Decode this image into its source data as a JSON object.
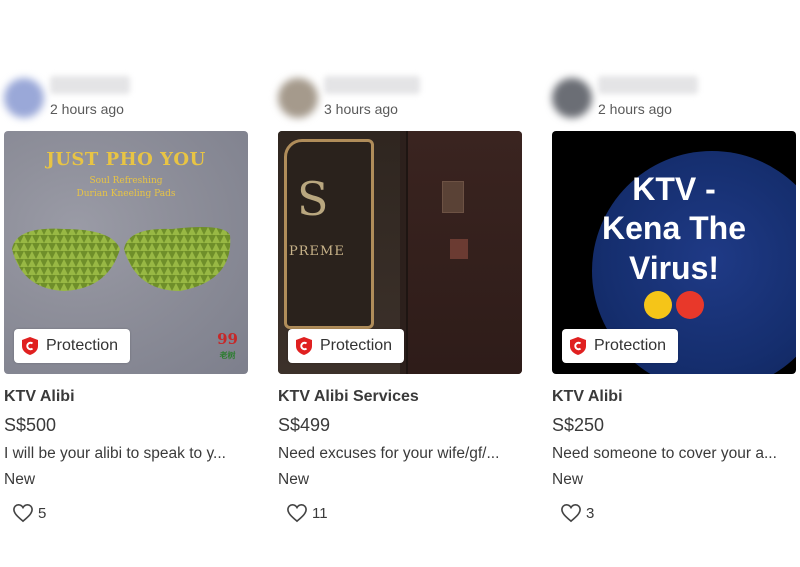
{
  "listings": [
    {
      "time": "2 hours ago",
      "title": "KTV Alibi",
      "price": "S$500",
      "description": "I will be your alibi to speak to y...",
      "condition": "New",
      "likes": "5",
      "protection": "Protection",
      "image": {
        "headline": "JUST PHO YOU",
        "subline1": "Soul Refreshing",
        "subline2": "Durian Kneeling Pads",
        "logo": "99",
        "logo_sub": "老树"
      }
    },
    {
      "time": "3 hours ago",
      "title": "KTV Alibi Services",
      "price": "S$499",
      "description": "Need excuses for your wife/gf/...",
      "condition": "New",
      "likes": "11",
      "protection": "Protection",
      "image": {
        "sign_letter": "S",
        "sign_text": "PREME"
      }
    },
    {
      "time": "2 hours ago",
      "title": "KTV Alibi",
      "price": "S$250",
      "description": "Need someone to cover your a...",
      "condition": "New",
      "likes": "3",
      "protection": "Protection",
      "image": {
        "line1": "KTV -",
        "line2": "Kena The",
        "line3": "Virus!"
      }
    }
  ],
  "colors": {
    "protection_red": "#e02020",
    "durian_text": "#e8c444",
    "virus_blue": "#1f3a86"
  },
  "icons": {
    "protection": "shield-check-icon",
    "like": "heart-outline-icon"
  }
}
